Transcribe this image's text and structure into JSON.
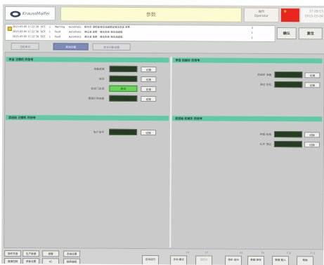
{
  "header": {
    "logo_text": "KraussMaffei",
    "title": "参数",
    "operator_line1": "操作",
    "operator_line2": "Operator",
    "clock_time": "17:28:15",
    "clock_date": "2015-03-04",
    "flag_icon": "china-flag"
  },
  "alarms": {
    "rows": [
      {
        "time": "2015-03-05 17:22:38",
        "code": "SCE",
        "n": "1",
        "type": "Warning",
        "src": "Automatic",
        "msg": "操作员 请检查液压油温度或液压系统 参数",
        "count": "3"
      },
      {
        "time": "2015-03-05 17:22:38",
        "code": "SCE",
        "n": "1",
        "type": "Fault",
        "src": "Automatic",
        "msg": "液压油 温度 - 液压系统 液压油温度",
        "count": "1"
      },
      {
        "time": "2015-03-05 17:22:38",
        "code": "SCE",
        "n": "1",
        "type": "Fault",
        "src": "Automatic",
        "msg": "液压油 温度 - 液压系统 液压油温度",
        "count": "1"
      }
    ],
    "ack_label": "确认",
    "reset_label": "复位"
  },
  "tabs": [
    {
      "label": "注射单元"
    },
    {
      "label": "其他功能"
    },
    {
      "label": "其它功能设置"
    }
  ],
  "sections": {
    "left_top": {
      "title": "来自 注塑机 的信号",
      "rows": [
        {
          "label": "准备就绪",
          "value": "",
          "button": "切换"
        },
        {
          "label": "自动",
          "value": "",
          "button": "切换"
        },
        {
          "label": "安全门关闭",
          "value": "启动",
          "button": "切换"
        },
        {
          "label": "模具打开结束",
          "value": "",
          "button": "切换"
        }
      ]
    },
    "left_bottom": {
      "title": "发送给 注塑机 的信号",
      "rows": [
        {
          "label": "生产信号",
          "value": "",
          "button": "切换"
        }
      ]
    },
    "right_top": {
      "title": "来自 机械手 的信号",
      "rows": [
        {
          "label": "机械手 准备",
          "value": "",
          "button": "切换"
        },
        {
          "label": "原位 到位",
          "value": "",
          "button": "切换"
        }
      ]
    },
    "right_bottom": {
      "title": "发送给 机械手 的信号",
      "rows": [
        {
          "label": "开模 结束",
          "value": "",
          "button": "切换"
        },
        {
          "label": "允许 顶出",
          "value": "",
          "button": "切换"
        }
      ]
    }
  },
  "bottom": {
    "nav_top": [
      "操作界面",
      "生产数据",
      "报警",
      "系统设置"
    ],
    "nav_bottom": [
      "温度控制",
      "参数设置",
      "IO",
      "趋势曲线"
    ],
    "functions": [
      {
        "key": "",
        "label": "自动运行"
      },
      {
        "key": "F6",
        "label": "手动 模式"
      },
      {
        "key": "F7",
        "label": "回原点"
      },
      {
        "key": "F8",
        "label": "单步 运行"
      },
      {
        "key": "F9",
        "label": "数据 保存"
      },
      {
        "key": "F10",
        "label": "数据 载入"
      },
      {
        "key": "F11",
        "label": "帮助"
      }
    ]
  },
  "colors": {
    "section_header": "#60c9a6",
    "active_tab": "#7d8bb8",
    "status_field": "#253b22",
    "status_live": "#66d456",
    "title_bg": "#fdfbd2"
  }
}
